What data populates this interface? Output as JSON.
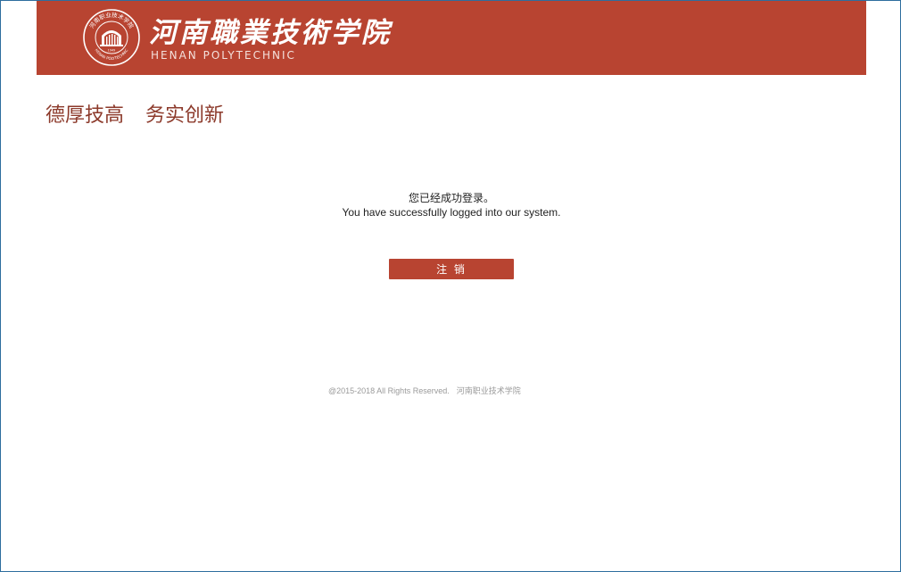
{
  "header": {
    "brand_cn": "河南職業技術学院",
    "brand_en": "HENAN POLYTECHNIC",
    "seal_text_top": "河南职业技术学院",
    "seal_text_bottom": "HENAN POLYTECHNIC",
    "seal_year": "1949"
  },
  "slogan": {
    "part1": "德厚技高",
    "part2": "务实创新"
  },
  "message": {
    "cn": "您已经成功登录。",
    "en": "You have successfully logged into our system."
  },
  "actions": {
    "logout_label": "注 销"
  },
  "footer": {
    "copyright": "@2015-2018 All Rights Reserved.",
    "org": "河南职业技术学院"
  },
  "colors": {
    "brand": "#b84431",
    "slogan": "#8c3a2b",
    "frame_border": "#2e6e9e"
  }
}
